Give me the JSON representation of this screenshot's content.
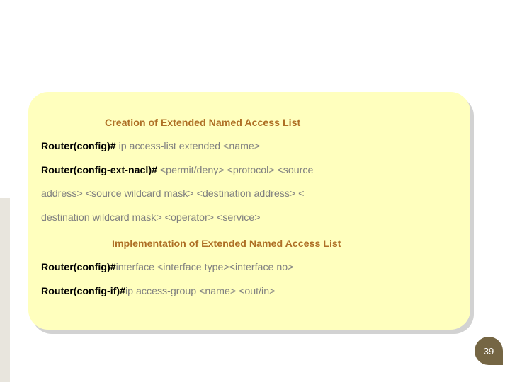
{
  "headings": {
    "creation": "Creation of Extended Named Access List",
    "implementation": "Implementation of Extended Named Access List"
  },
  "creation_block": {
    "line1_prompt": "Router(config)#",
    "line1_cmd": " ip access-list extended <name>",
    "line2_prompt": "Router(config-ext-nacl)#",
    "line2_cmd": " <permit/deny> <protocol>  <source",
    "line3": "address> <source wildcard mask> <destination address> <",
    "line4": "destination wildcard mask> <operator> <service>"
  },
  "implementation_block": {
    "line1_prompt": "Router(config)#",
    "line1_cmd": "interface <interface type><interface no>",
    "line2_prompt": "Router(config-if)#",
    "line2_cmd": "ip access-group <name> <out/in>"
  },
  "page_number": "39"
}
